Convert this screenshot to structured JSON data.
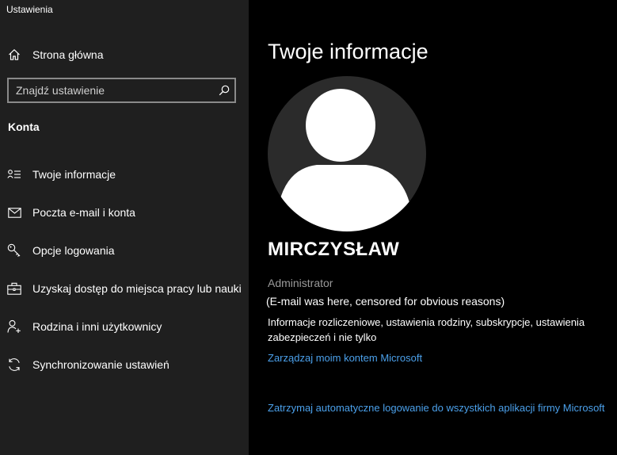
{
  "app": {
    "title": "Ustawienia"
  },
  "sidebar": {
    "home_label": "Strona główna",
    "search": {
      "placeholder": "Znajdź ustawienie",
      "value": ""
    },
    "section_title": "Konta",
    "items": [
      {
        "label": "Twoje informacje",
        "icon": "user-info-icon"
      },
      {
        "label": "Poczta e-mail i konta",
        "icon": "mail-icon"
      },
      {
        "label": "Opcje logowania",
        "icon": "key-icon"
      },
      {
        "label": "Uzyskaj dostęp do miejsca pracy lub nauki",
        "icon": "briefcase-icon"
      },
      {
        "label": "Rodzina i inni użytkownicy",
        "icon": "person-add-icon"
      },
      {
        "label": "Synchronizowanie ustawień",
        "icon": "sync-icon"
      }
    ]
  },
  "main": {
    "title": "Twoje informacje",
    "user": {
      "name": "MIRCZYSŁAW",
      "role": "Administrator",
      "email": "(E-mail was here, censored for obvious reasons)"
    },
    "info_text": "Informacje rozliczeniowe, ustawienia rodziny, subskrypcje, ustawienia zabezpieczeń i nie tylko",
    "links": {
      "manage_account": "Zarządzaj moim kontem Microsoft",
      "stop_auto_signin": "Zatrzymaj automatyczne logowanie do wszystkich aplikacji firmy Microsoft"
    }
  },
  "colors": {
    "sidebar_bg": "#1f1f1f",
    "main_bg": "#000000",
    "link": "#4ba0ea",
    "muted_text": "#9a9a9a",
    "search_border": "#8a8a8a"
  }
}
